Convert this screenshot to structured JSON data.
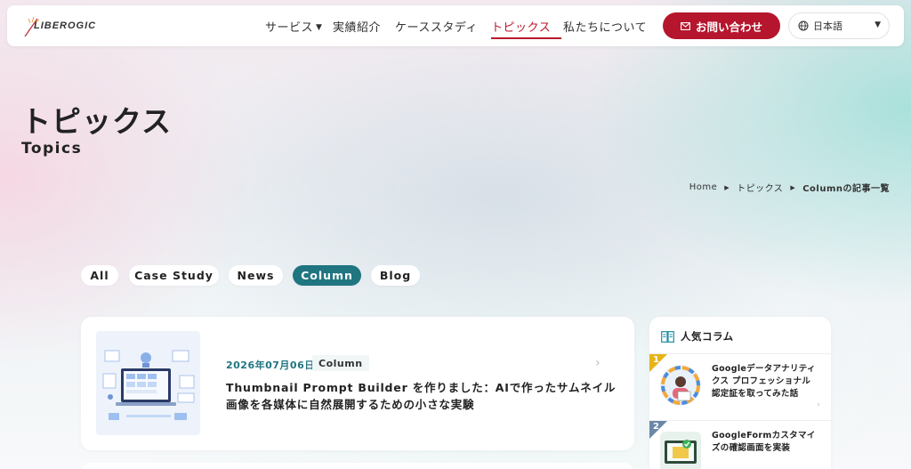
{
  "header": {
    "logo_text": "LIBEROGIC",
    "nav": {
      "services": "サービス",
      "results": "実績紹介",
      "case_study": "ケーススタディ",
      "topics": "トピックス",
      "about": "私たちについて"
    },
    "contact_label": "お問い合わせ",
    "language": "日本語"
  },
  "hero": {
    "title": "トピックス",
    "subtitle": "Topics"
  },
  "breadcrumb": {
    "home": "Home",
    "topics": "トピックス",
    "current": "Columnの記事一覧"
  },
  "filters": {
    "all": "All",
    "case_study": "Case Study",
    "news": "News",
    "column": "Column",
    "blog": "Blog",
    "active": "Column"
  },
  "article": {
    "date": "2026年07月06日",
    "tag": "Column",
    "title": "Thumbnail Prompt Builder を作りました：AIで作ったサムネイル画像を各媒体に自然展開するための小さな実験"
  },
  "sidebar": {
    "heading": "人気コラム",
    "items": [
      {
        "rank": "1",
        "title": "Googleデータアナリティクス プロフェッショナル認定証を取ってみた話",
        "rank_color": "#e7b315"
      },
      {
        "rank": "2",
        "title": "GoogleFormカスタマイズの確認画面を実装",
        "rank_color": "#6b87a8"
      }
    ]
  },
  "colors": {
    "brand_red": "#b5162d",
    "accent_teal": "#1f7580"
  }
}
